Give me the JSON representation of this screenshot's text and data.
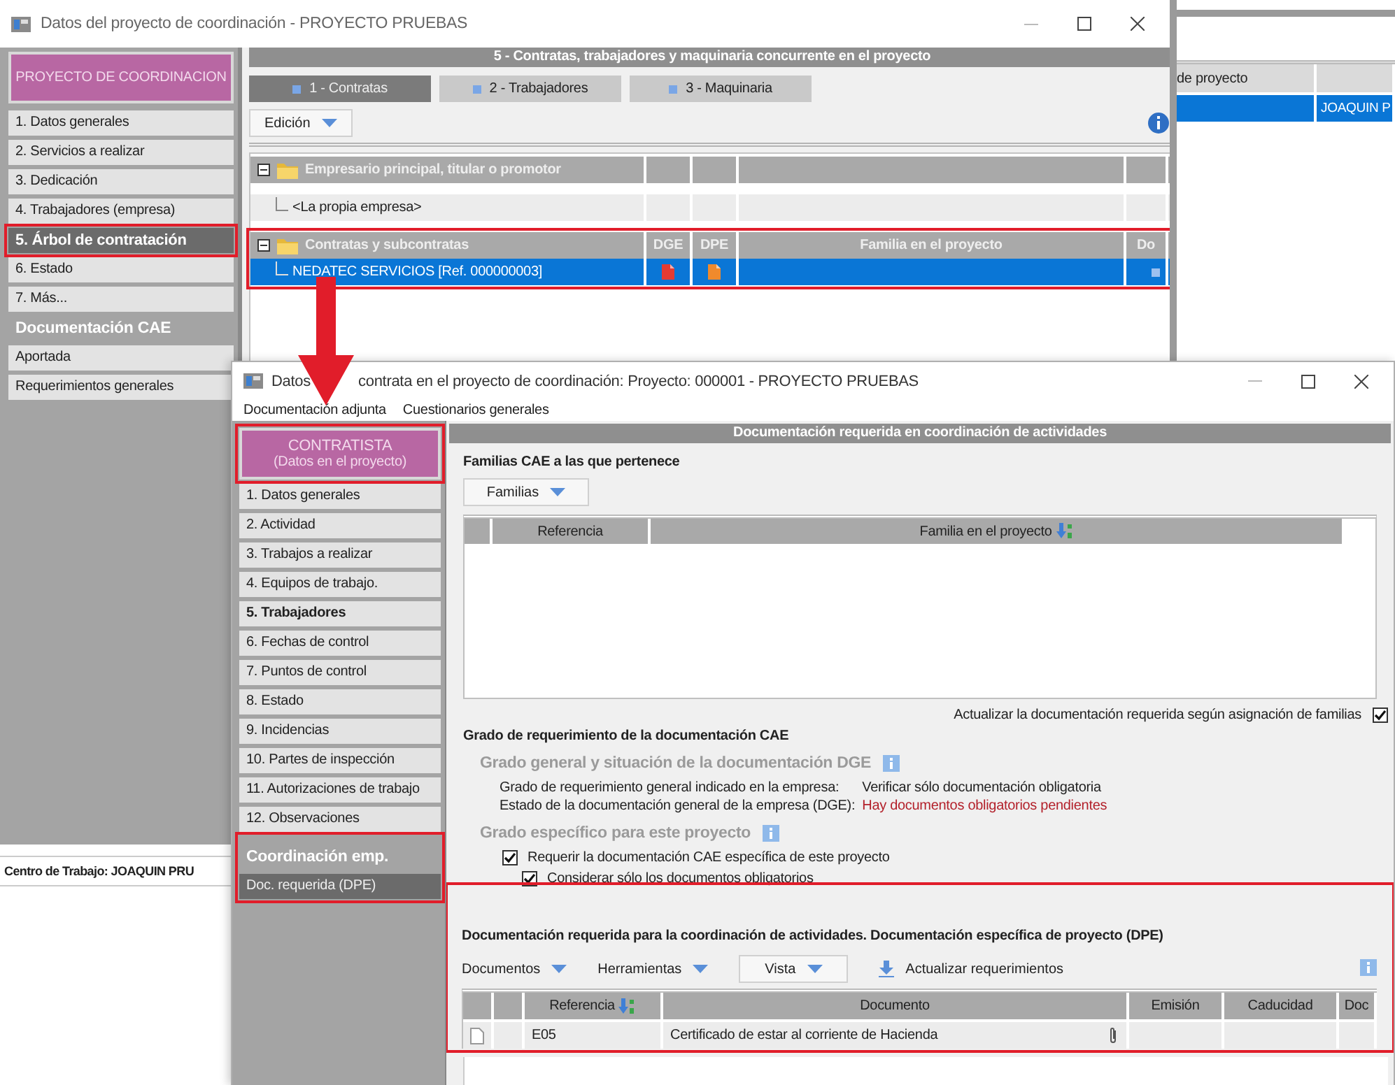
{
  "back_window": {
    "title": "Datos del proyecto de coordinación -  PROYECTO PRUEBAS",
    "sidebar": {
      "header": "PROYECTO DE COORDINACION",
      "groups": [
        {
          "items": [
            {
              "label": "1. Datos generales",
              "selected": false,
              "highlighted": false
            },
            {
              "label": "2. Servicios a realizar",
              "selected": false,
              "highlighted": false
            },
            {
              "label": "3. Dedicación",
              "selected": false,
              "highlighted": false
            },
            {
              "label": "4. Trabajadores (empresa)",
              "selected": false,
              "highlighted": false
            },
            {
              "label": "5. Árbol de contratación",
              "selected": true,
              "highlighted": true
            },
            {
              "label": "6. Estado",
              "selected": false,
              "highlighted": false
            },
            {
              "label": "7. Más...",
              "selected": false,
              "highlighted": false
            }
          ]
        },
        {
          "title": "Documentación CAE",
          "items": [
            {
              "label": "Aportada",
              "selected": false,
              "highlighted": false
            },
            {
              "label": "Requerimientos generales",
              "selected": false,
              "highlighted": false
            }
          ]
        }
      ]
    },
    "status_bar": "Centro de Trabajo: JOAQUIN PRU",
    "section_header": "5 - Contratas, trabajadores y maquinaria concurrente en el proyecto",
    "tabs": [
      {
        "label": "1 - Contratas",
        "selected": true
      },
      {
        "label": "2 - Trabajadores",
        "selected": false
      },
      {
        "label": "3 - Maquinaria",
        "selected": false
      }
    ],
    "edit_menu": "Edición",
    "tree": [
      {
        "label": "Empresario principal, titular o promotor",
        "expanded": true,
        "children": [
          {
            "kind": "placeholder",
            "label": "<La propia empresa>",
            "selected": false
          }
        ]
      },
      {
        "label": "Contratas y subcontratas",
        "expanded": true,
        "highlighted": true,
        "columns": [
          "DGE",
          "DPE",
          "Familia en el proyecto",
          "Do"
        ],
        "children": [
          {
            "kind": "contract",
            "label": "NEDATEC SERVICIOS  [Ref. 000000003]",
            "selected": true
          }
        ]
      }
    ]
  },
  "side_window": {
    "column_1": "de proyecto",
    "rows": [
      {
        "column_2": "JOAQUIN P",
        "selected": true
      }
    ]
  },
  "front_window": {
    "title_start": "Datos",
    "title_end": "contrata en el proyecto de coordinación: Proyecto: 000001 - PROYECTO PRUEBAS",
    "menu": [
      "Documentación adjunta",
      "Cuestionarios generales"
    ],
    "sidebar": {
      "header": [
        "CONTRATISTA",
        "(Datos en el proyecto)"
      ],
      "header_highlighted": true,
      "groups": [
        {
          "items": [
            {
              "label": "1. Datos generales",
              "selected": false,
              "emphasized": false
            },
            {
              "label": "2. Actividad",
              "selected": false,
              "emphasized": false
            },
            {
              "label": "3. Trabajos a realizar",
              "selected": false,
              "emphasized": false
            },
            {
              "label": "4. Equipos de trabajo.",
              "selected": false,
              "emphasized": false
            },
            {
              "label": "5. Trabajadores",
              "selected": false,
              "emphasized": true
            },
            {
              "label": "6. Fechas de control",
              "selected": false,
              "emphasized": false
            },
            {
              "label": "7. Puntos de control",
              "selected": false,
              "emphasized": false
            },
            {
              "label": "8. Estado",
              "selected": false,
              "emphasized": false
            },
            {
              "label": "9. Incidencias",
              "selected": false,
              "emphasized": false
            },
            {
              "label": "10. Partes de inspección",
              "selected": false,
              "emphasized": false
            },
            {
              "label": "11. Autorizaciones de trabajo",
              "selected": false,
              "emphasized": false
            },
            {
              "label": "12. Observaciones",
              "selected": false,
              "emphasized": false
            }
          ]
        },
        {
          "highlighted": true,
          "title": "Coordinación emp.",
          "items": [
            {
              "label": "Doc. requerida (DPE)",
              "selected": true,
              "emphasized": false
            }
          ]
        }
      ]
    },
    "header": "Documentación requerida en coordinación de actividades",
    "families": {
      "title": "Familias CAE a las que pertenece",
      "menu": "Familias",
      "columns": [
        {
          "label": "Referencia",
          "sorted": false
        },
        {
          "label": "Familia en el proyecto",
          "sorted": true
        }
      ],
      "update_option": {
        "label": "Actualizar la documentación requerida según asignación de familias",
        "checked": true
      }
    },
    "grade": {
      "title": "Grado de requerimiento de la documentación CAE",
      "general": {
        "title": "Grado general y situación de la documentación DGE",
        "rows": [
          {
            "label": "Grado de requerimiento general indicado en la empresa:",
            "value": "Verificar sólo documentación obligatoria",
            "alert": false
          },
          {
            "label": "Estado de la documentación general de la empresa (DGE):",
            "value": "Hay documentos obligatorios pendientes",
            "alert": true
          }
        ]
      },
      "specific": {
        "title": "Grado específico para este proyecto",
        "options": [
          {
            "label": "Requerir la documentación CAE específica de este proyecto",
            "checked": true,
            "children": [
              {
                "label": "Considerar sólo los documentos obligatorios",
                "checked": true
              }
            ]
          }
        ]
      }
    },
    "dpe": {
      "highlighted": true,
      "title": "Documentación requerida para la coordinación de actividades. Documentación específica de proyecto (DPE)",
      "toolbar": [
        {
          "kind": "menu",
          "label": "Documentos"
        },
        {
          "kind": "menu",
          "label": "Herramientas"
        },
        {
          "kind": "menu_button",
          "label": "Vista"
        },
        {
          "kind": "action",
          "label": "Actualizar requerimientos"
        }
      ],
      "columns": [
        {
          "label": "Referencia",
          "sorted": true
        },
        {
          "label": "Documento",
          "sorted": false
        },
        {
          "label": "Emisión",
          "sorted": false
        },
        {
          "label": "Caducidad",
          "sorted": false
        },
        {
          "label": "Doc",
          "sorted": false
        }
      ],
      "rows": [
        {
          "reference": "E05",
          "document": "Certificado de estar al corriente de Hacienda",
          "attachment": true
        }
      ]
    }
  }
}
